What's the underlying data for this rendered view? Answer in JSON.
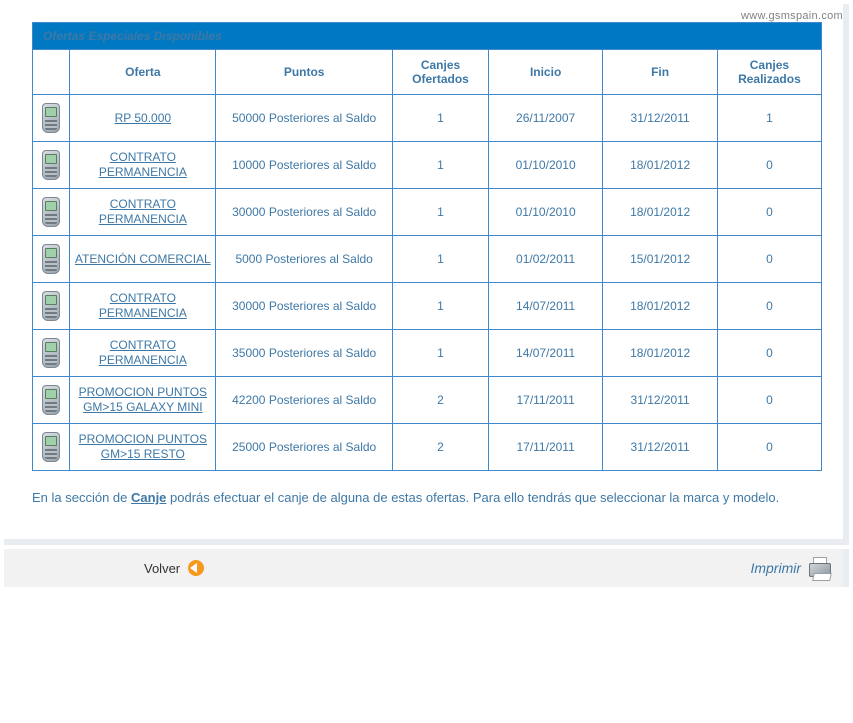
{
  "meta": {
    "watermark": "www.gsmspain.com"
  },
  "table": {
    "title": "Ofertas Especiales Disponibles",
    "headers": {
      "oferta": "Oferta",
      "puntos": "Puntos",
      "canjes_ofertados": "Canjes Ofertados",
      "inicio": "Inicio",
      "fin": "Fin",
      "canjes_realizados": "Canjes Realizados"
    },
    "rows": [
      {
        "oferta": "RP 50.000",
        "puntos": "50000 Posteriores al Saldo",
        "co": "1",
        "inicio": "26/11/2007",
        "fin": "31/12/2011",
        "cr": "1"
      },
      {
        "oferta": "CONTRATO PERMANENCIA",
        "puntos": "10000 Posteriores al Saldo",
        "co": "1",
        "inicio": "01/10/2010",
        "fin": "18/01/2012",
        "cr": "0"
      },
      {
        "oferta": "CONTRATO PERMANENCIA",
        "puntos": "30000 Posteriores al Saldo",
        "co": "1",
        "inicio": "01/10/2010",
        "fin": "18/01/2012",
        "cr": "0"
      },
      {
        "oferta": "ATENCIÓN COMERCIAL",
        "puntos": "5000 Posteriores al Saldo",
        "co": "1",
        "inicio": "01/02/2011",
        "fin": "15/01/2012",
        "cr": "0"
      },
      {
        "oferta": "CONTRATO PERMANENCIA",
        "puntos": "30000 Posteriores al Saldo",
        "co": "1",
        "inicio": "14/07/2011",
        "fin": "18/01/2012",
        "cr": "0"
      },
      {
        "oferta": "CONTRATO PERMANENCIA",
        "puntos": "35000 Posteriores al Saldo",
        "co": "1",
        "inicio": "14/07/2011",
        "fin": "18/01/2012",
        "cr": "0"
      },
      {
        "oferta": "PROMOCION PUNTOS GM>15 GALAXY MINI",
        "puntos": "42200 Posteriores al Saldo",
        "co": "2",
        "inicio": "17/11/2011",
        "fin": "31/12/2011",
        "cr": "0"
      },
      {
        "oferta": "PROMOCION PUNTOS GM>15 RESTO",
        "puntos": "25000 Posteriores al Saldo",
        "co": "2",
        "inicio": "17/11/2011",
        "fin": "31/12/2011",
        "cr": "0"
      }
    ]
  },
  "info": {
    "prefix": "En la sección de ",
    "link": "Canje",
    "suffix": " podrás efectuar el canje de alguna de estas ofertas.  Para ello tendrás que seleccionar la marca y modelo."
  },
  "footer": {
    "back_label": "Volver",
    "print_label": "Imprimir"
  }
}
